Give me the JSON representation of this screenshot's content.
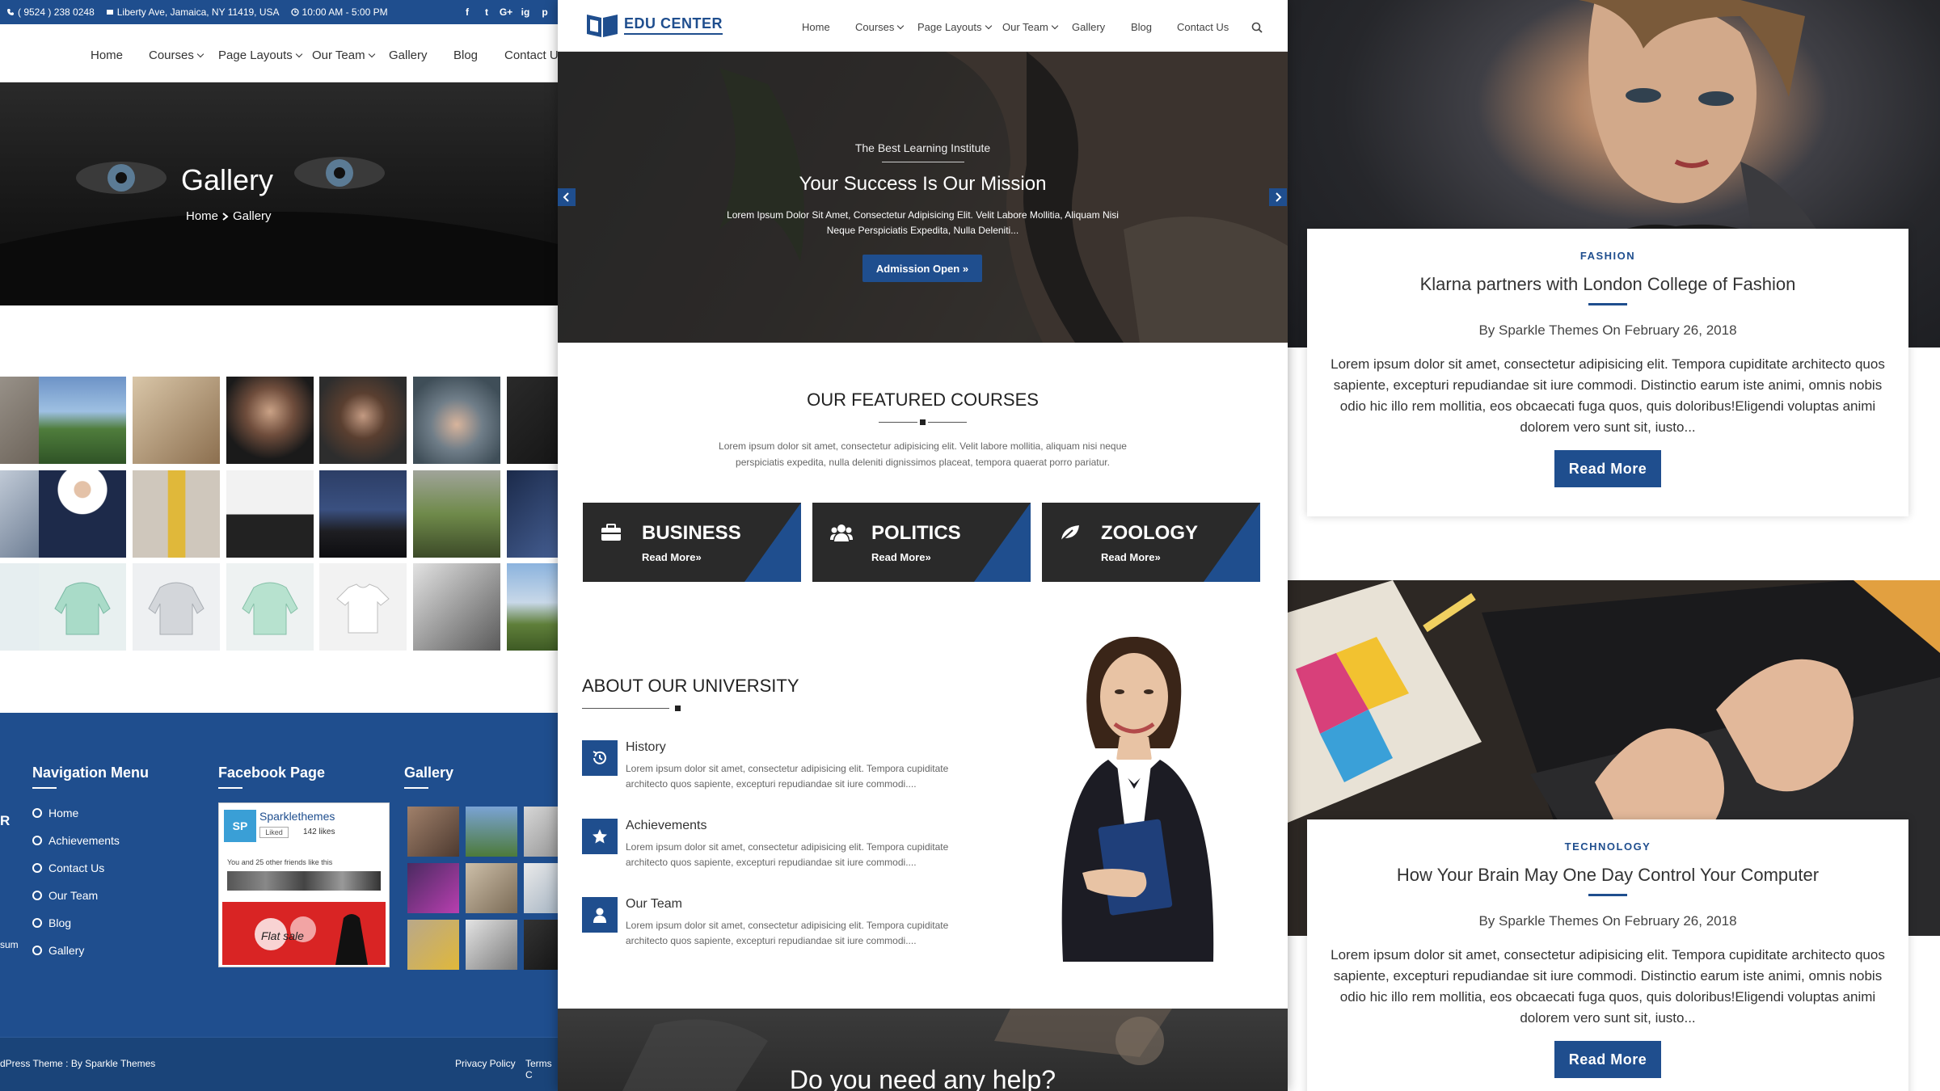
{
  "left": {
    "topbar": {
      "phone": "( 9524 ) 238 0248",
      "address": "Liberty Ave, Jamaica, NY 11419, USA",
      "hours": "10:00 AM - 5:00 PM",
      "social": [
        "f",
        "t",
        "G+",
        "ig",
        "p"
      ]
    },
    "nav": [
      "Home",
      "Courses",
      "Page Layouts",
      "Our Team",
      "Gallery",
      "Blog",
      "Contact U"
    ],
    "hero": {
      "title": "Gallery",
      "crumb_home": "Home",
      "crumb_current": "Gallery"
    },
    "footer": {
      "nav_title": "Navigation Menu",
      "fb_title": "Facebook Page",
      "gallery_title": "Gallery",
      "nav_items": [
        "Home",
        "Achievements",
        "Contact Us",
        "Our Team",
        "Blog",
        "Gallery"
      ],
      "fb_name": "Sparklethemes",
      "fb_liked": "Liked",
      "fb_likes": "142 likes",
      "fb_friends": "You and 25 other friends like this",
      "fb_promo": "Flat sale",
      "edge_r": "R",
      "edge_sum": "sum",
      "bottom_left": "dPress Theme : By Sparkle Themes",
      "bottom_links": [
        "Privacy Policy",
        "Terms C"
      ]
    }
  },
  "center": {
    "logo": "EDU CENTER",
    "nav": [
      "Home",
      "Courses",
      "Page Layouts",
      "Our Team",
      "Gallery",
      "Blog",
      "Contact Us"
    ],
    "hero": {
      "sub": "The Best Learning Institute",
      "heading": "Your Success Is Our Mission",
      "desc": "Lorem Ipsum Dolor Sit Amet, Consectetur Adipisicing Elit. Velit Labore Mollitia, Aliquam Nisi Neque Perspiciatis Expedita, Nulla Deleniti...",
      "button": "Admission Open »"
    },
    "featured": {
      "title": "OUR FEATURED COURSES",
      "desc": "Lorem ipsum dolor sit amet, consectetur adipisicing elit. Velit labore mollitia, aliquam nisi neque perspiciatis expedita, nulla deleniti dignissimos placeat, tempora quaerat porro pariatur.",
      "courses": [
        {
          "name": "BUSINESS",
          "link": "Read More»"
        },
        {
          "name": "POLITICS",
          "link": "Read More»"
        },
        {
          "name": "ZOOLOGY",
          "link": "Read More»"
        }
      ]
    },
    "about": {
      "title": "ABOUT OUR UNIVERSITY",
      "items": [
        {
          "title": "History",
          "desc": "Lorem ipsum dolor sit amet, consectetur adipisicing elit. Tempora cupiditate architecto quos sapiente, excepturi repudiandae sit iure commodi...."
        },
        {
          "title": "Achievements",
          "desc": "Lorem ipsum dolor sit amet, consectetur adipisicing elit. Tempora cupiditate architecto quos sapiente, excepturi repudiandae sit iure commodi...."
        },
        {
          "title": "Our Team",
          "desc": "Lorem ipsum dolor sit amet, consectetur adipisicing elit. Tempora cupiditate architecto quos sapiente, excepturi repudiandae sit iure commodi...."
        }
      ]
    },
    "cta": "Do you need any help?"
  },
  "right": {
    "posts": [
      {
        "category": "FASHION",
        "title": "Klarna partners with London College of Fashion",
        "meta": "By Sparkle Themes  On February 26, 2018",
        "body": "Lorem ipsum dolor sit amet, consectetur adipisicing elit. Tempora cupiditate architecto quos sapiente, excepturi repudiandae sit iure commodi. Distinctio earum iste animi, omnis nobis odio hic illo rem mollitia, eos obcaecati fuga quos, quis doloribus!Eligendi voluptas animi dolorem vero sunt sit, iusto...",
        "button": "Read More"
      },
      {
        "category": "TECHNOLOGY",
        "title": "How Your Brain May One Day Control Your Computer",
        "meta": "By Sparkle Themes  On February 26, 2018",
        "body": "Lorem ipsum dolor sit amet, consectetur adipisicing elit. Tempora cupiditate architecto quos sapiente, excepturi repudiandae sit iure commodi. Distinctio earum iste animi, omnis nobis odio hic illo rem mollitia, eos obcaecati fuga quos, quis doloribus!Eligendi voluptas animi dolorem vero sunt sit, iusto...",
        "button": "Read More"
      }
    ]
  },
  "colors": {
    "brand": "#1f4e8e",
    "dark": "#2a2a2a"
  }
}
